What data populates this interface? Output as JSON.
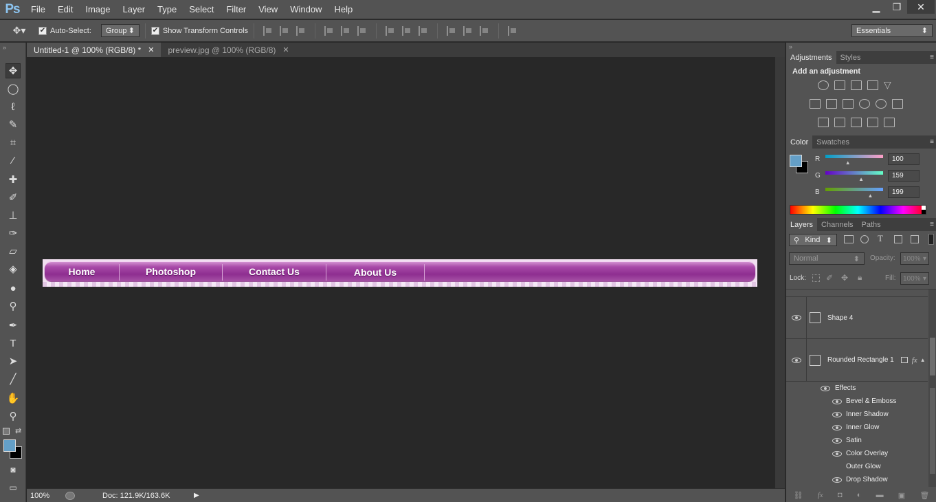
{
  "app": {
    "logo": "Ps"
  },
  "menu": [
    "File",
    "Edit",
    "Image",
    "Layer",
    "Type",
    "Select",
    "Filter",
    "View",
    "Window",
    "Help"
  ],
  "window_controls": {
    "minimize": "▁",
    "restore": "❐",
    "close": "✕"
  },
  "options_bar": {
    "auto_select_label": "Auto-Select:",
    "auto_select_value": "Group",
    "show_transform_label": "Show Transform Controls",
    "workspace": "Essentials"
  },
  "doc_tabs": [
    {
      "label": "Untitled-1 @ 100% (RGB/8) *",
      "active": true
    },
    {
      "label": "preview.jpg @ 100% (RGB/8)",
      "active": false
    }
  ],
  "canvas": {
    "nav_items": [
      "Home",
      "Photoshop",
      "Contact Us",
      "About Us"
    ]
  },
  "status": {
    "zoom": "100%",
    "doc": "Doc: 121.9K/163.6K"
  },
  "panels": {
    "adjustments_tab": "Adjustments",
    "styles_tab": "Styles",
    "add_adjustment": "Add an adjustment",
    "color_tab": "Color",
    "swatches_tab": "Swatches",
    "color": {
      "r_label": "R",
      "g_label": "G",
      "b_label": "B",
      "r": "100",
      "g": "159",
      "b": "199",
      "foreground": "#649fc7",
      "r_fraction": 0.39,
      "g_fraction": 0.62,
      "b_fraction": 0.78
    },
    "layers_tab": "Layers",
    "channels_tab": "Channels",
    "paths_tab": "Paths",
    "kind_label": "Kind",
    "blend_mode": "Normal",
    "opacity_label": "Opacity:",
    "opacity_value": "100%",
    "lock_label": "Lock:",
    "fill_label": "Fill:",
    "fill_value": "100%",
    "layers": [
      {
        "name": "Shape 4"
      },
      {
        "name": "Rounded Rectangle 1"
      }
    ],
    "effects_label": "Effects",
    "effects": [
      {
        "name": "Bevel & Emboss",
        "visible": true
      },
      {
        "name": "Inner Shadow",
        "visible": true
      },
      {
        "name": "Inner Glow",
        "visible": true
      },
      {
        "name": "Satin",
        "visible": true
      },
      {
        "name": "Color Overlay",
        "visible": true
      },
      {
        "name": "Outer Glow",
        "visible": false
      },
      {
        "name": "Drop Shadow",
        "visible": true
      }
    ]
  }
}
